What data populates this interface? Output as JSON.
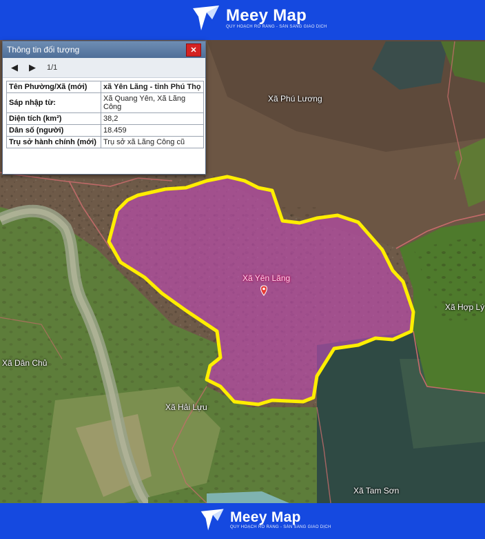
{
  "brand": {
    "name": "Meey Map",
    "tagline": "QUY HOẠCH RÕ RÀNG - SẴN SÀNG GIAO DỊCH"
  },
  "panel": {
    "title": "Thông tin đối tượng",
    "close": "✕",
    "prev": "◀",
    "next": "▶",
    "page": "1/1",
    "rows": [
      {
        "key": "Tên Phường/Xã (mới)",
        "value": "xã Yên Lãng - tỉnh Phú Thọ"
      },
      {
        "key": "Sáp nhập từ:",
        "value": "Xã Quang Yên, Xã Lãng Công"
      },
      {
        "key": "Diện tích (km²)",
        "value": "38,2"
      },
      {
        "key": "Dân số (người)",
        "value": "18.459"
      },
      {
        "key": "Trụ sở hành chính (mới)",
        "value": "Trụ sở xã Lãng Công cũ"
      }
    ]
  },
  "map": {
    "selected_area": "Xã Yên Lãng",
    "labels": [
      "Xã Phú Lương",
      "Xã Hợp Lý",
      "Xã Dân Chủ",
      "Xã Hải Lựu",
      "Xã Tam Sơn"
    ],
    "colors": {
      "highlight_fill": "#c24bb8",
      "highlight_stroke": "#ffee00",
      "marker": "#e53935"
    }
  }
}
